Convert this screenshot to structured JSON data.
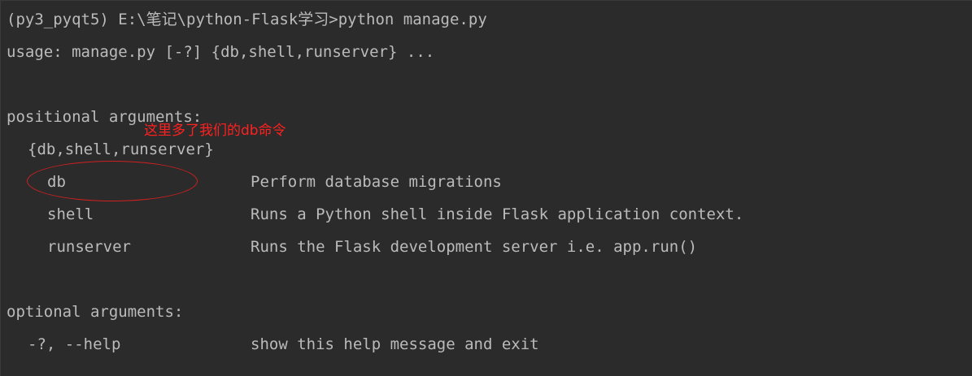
{
  "prompt": {
    "command_line": "(py3_pyqt5) E:\\笔记\\python-Flask学习>python manage.py"
  },
  "usage": {
    "text": "usage: manage.py [-?] {db,shell,runserver} ..."
  },
  "positional": {
    "header": "positional arguments:",
    "group": "{db,shell,runserver}",
    "commands": [
      {
        "name": "db",
        "description": "Perform database migrations"
      },
      {
        "name": "shell",
        "description": "Runs a Python shell inside Flask application context."
      },
      {
        "name": "runserver",
        "description": "Runs the Flask development server i.e. app.run()"
      }
    ]
  },
  "optional": {
    "header": "optional arguments:",
    "options": [
      {
        "flags": "-?, --help",
        "description": "show this help message and exit"
      }
    ]
  },
  "annotation": {
    "text": "这里多了我们的db命令",
    "color": "#ff2020"
  }
}
